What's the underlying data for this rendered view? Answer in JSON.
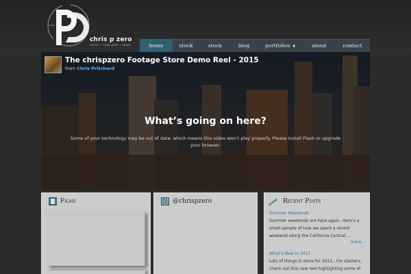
{
  "brand": {
    "name": "chris p zero",
    "tagline": "PHOTO • TIMELAPSE • VIDEO"
  },
  "nav": [
    {
      "label": "home",
      "active": true
    },
    {
      "label": "stock",
      "active": false
    },
    {
      "label": "stock",
      "active": false
    },
    {
      "label": "blog",
      "active": false
    },
    {
      "label": "portfolios",
      "active": false,
      "dropdown": true
    },
    {
      "label": "about",
      "active": false
    },
    {
      "label": "contact",
      "active": false
    }
  ],
  "video": {
    "title": "The chrispzero Footage Store Demo Reel - 2015",
    "from_label": "from",
    "author": "Chris Pritchard",
    "message_heading": "What’s going on here?",
    "message_body": "Some of your technology may be out of date, which means this video won’t play properly. Please install Flash or upgrade your browser."
  },
  "widgets": {
    "films": {
      "title": "Films",
      "icon": "film-icon"
    },
    "twitter": {
      "title": "@chrispzero",
      "icon": "twitter-icon"
    },
    "recent": {
      "title": "Recent Posts",
      "icon": "pen-icon",
      "posts": [
        {
          "title": "Summer Weekends",
          "body": "Summer weekends are here again. Here’s a small sample of how we spent a recent weekend along the California Central...",
          "more": "more..."
        },
        {
          "title": "What’s New in 2015",
          "body": "Lots of things in store for 2015.. For starters, check out this new reel highlighting some of",
          "more": ""
        }
      ]
    }
  },
  "colors": {
    "accent": "#2f5f70",
    "link": "#2a6fb5",
    "nav_bg": "#3a4247",
    "widget_bg": "#cccccc"
  }
}
